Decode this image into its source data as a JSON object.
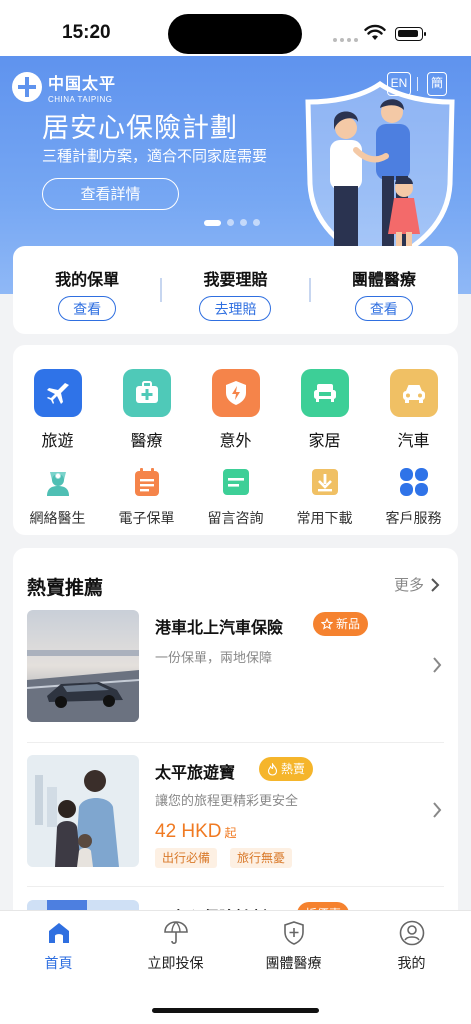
{
  "status_bar": {
    "time": "15:20"
  },
  "banner": {
    "logo_cn": "中国太平",
    "logo_en": "CHINA TAIPING",
    "lang_en": "EN",
    "lang_simplified": "簡",
    "title": "居安心保險計劃",
    "subtitle": "三種計劃方案，適合不同家庭需要",
    "button": "查看詳情",
    "slide_count": 4,
    "active_slide": 1
  },
  "quick_actions": [
    {
      "label": "我的保單",
      "button": "查看"
    },
    {
      "label": "我要理賠",
      "button": "去理賠"
    },
    {
      "label": "團體醫療",
      "button": "查看"
    }
  ],
  "categories": [
    {
      "name": "旅遊",
      "icon": "airplane-icon",
      "color": "#2f73e8"
    },
    {
      "name": "醫療",
      "icon": "medical-kit-icon",
      "color": "#4fc9b8"
    },
    {
      "name": "意外",
      "icon": "shield-bolt-icon",
      "color": "#f5844a"
    },
    {
      "name": "家居",
      "icon": "sofa-icon",
      "color": "#3dcf97"
    },
    {
      "name": "汽車",
      "icon": "car-icon",
      "color": "#f0c064"
    }
  ],
  "services": [
    {
      "name": "網絡醫生",
      "icon": "doctor-icon"
    },
    {
      "name": "電子保單",
      "icon": "e-policy-icon"
    },
    {
      "name": "留言咨詢",
      "icon": "message-icon"
    },
    {
      "name": "常用下載",
      "icon": "download-icon"
    },
    {
      "name": "客戶服務",
      "icon": "customer-service-icon"
    }
  ],
  "hot": {
    "title": "熱賣推薦",
    "more": "更多",
    "products": [
      {
        "name": "港車北上汽車保險",
        "tag": "新品",
        "tag_icon": "star-icon",
        "tag_color": "#f5822f",
        "desc": "一份保單，兩地保障"
      },
      {
        "name": "太平旅遊寶",
        "tag": "熱賣",
        "tag_icon": "flame-icon",
        "tag_color": "#f5b52b",
        "desc": "讓您的旅程更精彩更安全",
        "price": "42 HKD",
        "price_unit": "起",
        "chips": [
          "出行必備",
          "旅行無憂"
        ]
      },
      {
        "name": "居安心保險計劃",
        "tag": "折優惠",
        "tag_color": "#f5822f"
      }
    ]
  },
  "tabs": [
    {
      "label": "首頁",
      "icon": "home-icon",
      "active": true
    },
    {
      "label": "立即投保",
      "icon": "umbrella-icon",
      "active": false
    },
    {
      "label": "團體醫療",
      "icon": "shield-plus-icon",
      "active": false
    },
    {
      "label": "我的",
      "icon": "user-icon",
      "active": false
    }
  ],
  "colors": {
    "primary": "#2f6fe0",
    "banner": "#6a9ef0",
    "accent_orange": "#f07a22"
  }
}
